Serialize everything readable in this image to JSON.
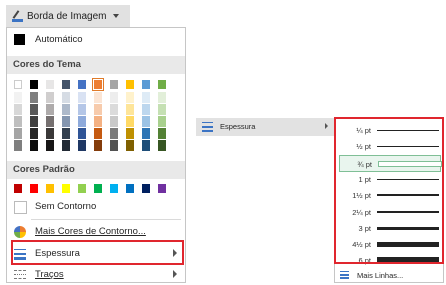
{
  "ribbon": {
    "label": "Borda de Imagem"
  },
  "menu": {
    "automatic": "Automático",
    "theme_colors_title": "Cores do Tema",
    "standard_colors_title": "Cores Padrão",
    "no_outline": "Sem Contorno",
    "more_colors": "Mais Cores de Contorno...",
    "weight": "Espessura",
    "dashes": "Traços"
  },
  "theme_colors": [
    [
      "#ffffff",
      "#000000",
      "#e7e6e6",
      "#44546a",
      "#4472c4",
      "#ed7d31",
      "#a5a5a5",
      "#ffc000",
      "#5b9bd5",
      "#70ad47"
    ],
    [
      "#f2f2f2",
      "#7f7f7f",
      "#d0cece",
      "#d6dce4",
      "#d9e2f3",
      "#fbe5d5",
      "#ededed",
      "#fff2cc",
      "#deebf6",
      "#e2efd9"
    ],
    [
      "#d8d8d8",
      "#595959",
      "#aeabab",
      "#adb9ca",
      "#b4c6e7",
      "#f7cbac",
      "#dbdbdb",
      "#fee599",
      "#bdd7ee",
      "#c5e0b3"
    ],
    [
      "#bfbfbf",
      "#3f3f3f",
      "#757070",
      "#8496b0",
      "#8eaadb",
      "#f4b183",
      "#c9c9c9",
      "#ffd965",
      "#9cc3e5",
      "#a8d08d"
    ],
    [
      "#a5a5a5",
      "#262626",
      "#3a3838",
      "#323f4f",
      "#2f5496",
      "#c55a11",
      "#7b7b7b",
      "#bf9000",
      "#2e75b5",
      "#538135"
    ],
    [
      "#7f7f7f",
      "#0c0c0c",
      "#171616",
      "#222a35",
      "#1f3864",
      "#843c0b",
      "#525252",
      "#7f6000",
      "#1e4e79",
      "#375623"
    ]
  ],
  "standard_colors": [
    "#c00000",
    "#ff0000",
    "#ffc000",
    "#ffff00",
    "#92d050",
    "#00b050",
    "#00b0f0",
    "#0070c0",
    "#002060",
    "#7030a0"
  ],
  "submenu": {
    "parent_label": "Espessura",
    "weights": [
      {
        "label": "¼ pt",
        "value_pt": 0.25
      },
      {
        "label": "½ pt",
        "value_pt": 0.5
      },
      {
        "label": "¾ pt",
        "value_pt": 0.75
      },
      {
        "label": "1 pt",
        "value_pt": 1
      },
      {
        "label": "1½ pt",
        "value_pt": 1.5
      },
      {
        "label": "2¼ pt",
        "value_pt": 2.25
      },
      {
        "label": "3 pt",
        "value_pt": 3
      },
      {
        "label": "4½ pt",
        "value_pt": 4.5
      },
      {
        "label": "6 pt",
        "value_pt": 6
      }
    ],
    "more_lines": "Mais Linhas..."
  },
  "colors": {
    "highlight": "#e0262e",
    "hover": "#e9f5ee"
  }
}
